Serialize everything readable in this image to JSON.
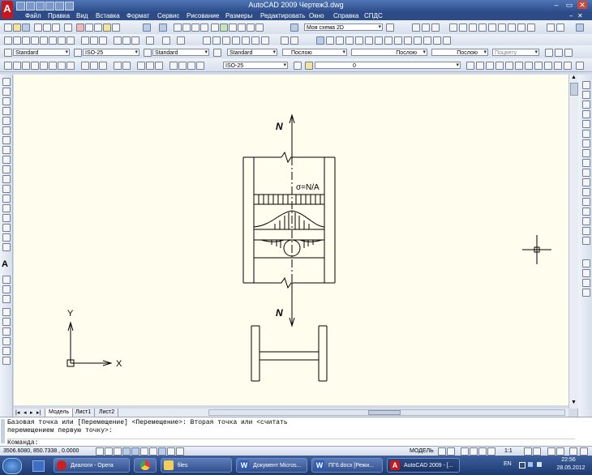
{
  "window": {
    "title": "AutoCAD 2009 Чертеж3.dwg"
  },
  "menu": [
    "Файл",
    "Правка",
    "Вид",
    "Вставка",
    "Формат",
    "Сервис",
    "Рисование",
    "Размеры",
    "Редактировать",
    "Окно",
    "Справка",
    "СПДС"
  ],
  "toolbar": {
    "workspace": "Моя схема 2D",
    "text_style": "Standard",
    "dim_style": "ISO-25",
    "table_style": "Standard",
    "multileader_style": "Standard",
    "color": "Послою",
    "linetype": "Послою",
    "lineweight": "Послою",
    "plotstyle": "Поцвету",
    "dim_style2": "ISO-25",
    "layer": "0"
  },
  "drawing": {
    "force_top": "N",
    "force_bottom": "N",
    "stress_label": "σ=N/A",
    "ucs_y": "Y",
    "ucs_x": "X"
  },
  "tabs": [
    "Модель",
    "Лист1",
    "Лист2"
  ],
  "command": {
    "line1": "Базовая точка или [Перемещение] <Перемещение>: Вторая точка или <считать",
    "line2": "перемещением первую точку>:",
    "prompt": "Команда:"
  },
  "status": {
    "coords": "3506.6080, 850.7338 , 0.0000",
    "model": "МОДЕЛЬ",
    "scale": "1:1"
  },
  "taskbar": {
    "items": [
      {
        "label": "Диалоги - Opera"
      },
      {
        "label": ""
      },
      {
        "label": "files"
      },
      {
        "label": "Документ Micros..."
      },
      {
        "label": "ПГ6.docx [Режи..."
      },
      {
        "label": "AutoCAD 2009 - [..."
      }
    ],
    "lang": "EN",
    "time": "22:56",
    "date": "28.05.2012"
  },
  "colors": {
    "accent": "#2d4c87",
    "canvas": "#fffeee",
    "opera": "#cc1f1f",
    "word": "#2e5bb8",
    "autocad": "#c8171c"
  }
}
